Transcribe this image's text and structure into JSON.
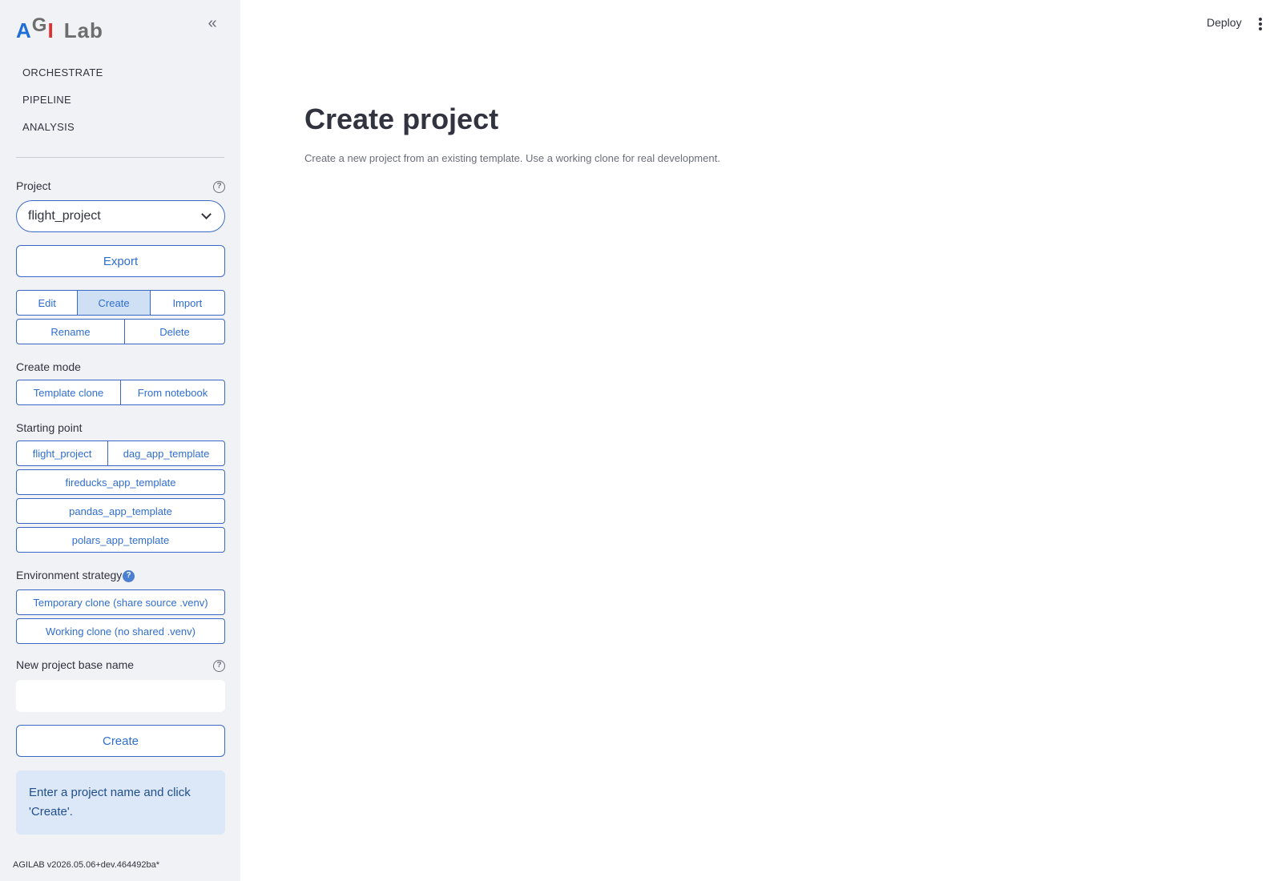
{
  "sidebar": {
    "logo": {
      "a": "A",
      "g": "G",
      "i": "I",
      "lab": "Lab"
    },
    "collapse_icon": "double-chevron-left-icon",
    "nav": [
      {
        "label": "ORCHESTRATE"
      },
      {
        "label": "PIPELINE"
      },
      {
        "label": "ANALYSIS"
      }
    ],
    "project_label": "Project",
    "project_value": "flight_project",
    "export_label": "Export",
    "actions_row1": [
      {
        "label": "Edit",
        "active": false
      },
      {
        "label": "Create",
        "active": true
      },
      {
        "label": "Import",
        "active": false
      }
    ],
    "actions_row2": [
      {
        "label": "Rename"
      },
      {
        "label": "Delete"
      }
    ],
    "create_mode_label": "Create mode",
    "create_modes": [
      {
        "label": "Template clone"
      },
      {
        "label": "From notebook"
      }
    ],
    "starting_point_label": "Starting point",
    "starting_points_row": [
      {
        "label": "flight_project"
      },
      {
        "label": "dag_app_template"
      }
    ],
    "starting_points": [
      {
        "label": "fireducks_app_template"
      },
      {
        "label": "pandas_app_template"
      },
      {
        "label": "polars_app_template"
      }
    ],
    "env_strategy_label": "Environment strategy",
    "env_strategies": [
      {
        "label": "Temporary clone (share source .venv)"
      },
      {
        "label": "Working clone (no shared .venv)"
      }
    ],
    "base_name_label": "New project base name",
    "base_name_value": "",
    "create_label": "Create",
    "info_text": "Enter a project name and click 'Create'.",
    "version": "AGILAB v2026.05.06+dev.464492ba*"
  },
  "header": {
    "deploy_label": "Deploy"
  },
  "main": {
    "title": "Create project",
    "subtitle": "Create a new project from an existing template. Use a working clone for real development."
  },
  "colors": {
    "sidebar_bg": "#f0f2f6",
    "accent": "#2f6ed0",
    "active_segment": "#cfe0f5",
    "info_bg": "#dce8f7"
  }
}
